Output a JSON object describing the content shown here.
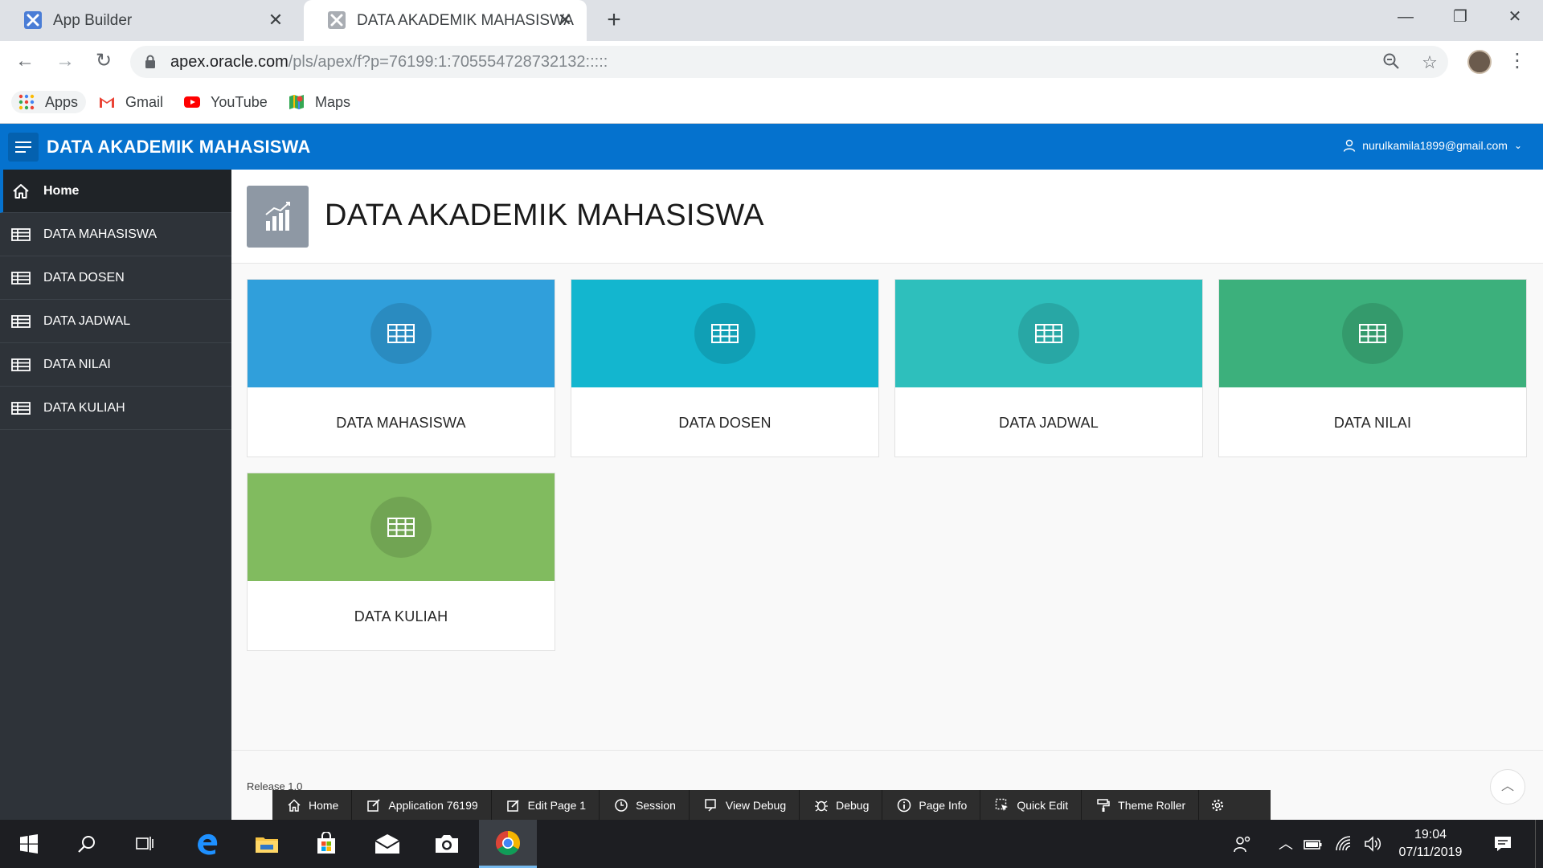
{
  "browser": {
    "tabs": [
      {
        "title": "App Builder",
        "favicon": "apex-app-builder-icon"
      },
      {
        "title": "DATA AKADEMIK MAHASISWA",
        "favicon": "apex-app-icon"
      }
    ],
    "url_host": "apex.oracle.com",
    "url_path": "/pls/apex/f?p=76199:1:705554728732132:::::",
    "bookmarks": [
      "Apps",
      "Gmail",
      "YouTube",
      "Maps"
    ]
  },
  "app": {
    "title": "DATA AKADEMIK MAHASISWA",
    "user": "nurulkamila1899@gmail.com"
  },
  "sidebar": {
    "items": [
      {
        "label": "Home",
        "icon": "home-icon",
        "active": true
      },
      {
        "label": "DATA MAHASISWA",
        "icon": "table-icon"
      },
      {
        "label": "DATA DOSEN",
        "icon": "table-icon"
      },
      {
        "label": "DATA JADWAL",
        "icon": "table-icon"
      },
      {
        "label": "DATA NILAI",
        "icon": "table-icon"
      },
      {
        "label": "DATA KULIAH",
        "icon": "table-icon"
      }
    ]
  },
  "hero": {
    "title": "DATA AKADEMIK MAHASISWA",
    "icon": "bar-chart-icon"
  },
  "cards": [
    {
      "label": "DATA MAHASISWA",
      "color": "#309fdb"
    },
    {
      "label": "DATA DOSEN",
      "color": "#13b6cf"
    },
    {
      "label": "DATA JADWAL",
      "color": "#2ebfbc"
    },
    {
      "label": "DATA NILAI",
      "color": "#3cb07c"
    },
    {
      "label": "DATA KULIAH",
      "color": "#81bb5f"
    }
  ],
  "footer": {
    "release": "Release 1.0"
  },
  "dev_toolbar": {
    "buttons": [
      "Home",
      "Application 76199",
      "Edit Page 1",
      "Session",
      "View Debug",
      "Debug",
      "Page Info",
      "Quick Edit",
      "Theme Roller"
    ]
  },
  "taskbar": {
    "time": "19:04",
    "date": "07/11/2019"
  },
  "colors": {
    "header": "#0572ce",
    "sidebar": "#2e3339",
    "dev_toolbar": "#2d2d2d"
  }
}
